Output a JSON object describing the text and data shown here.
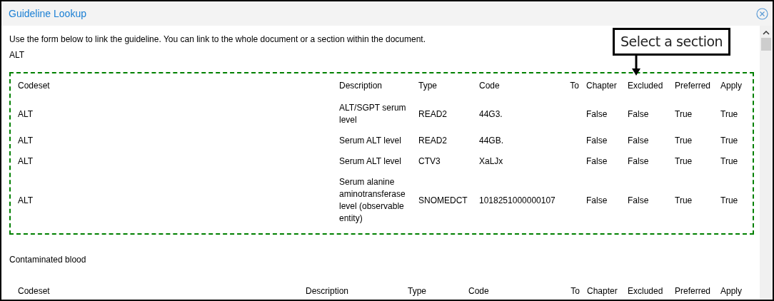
{
  "window": {
    "title": "Guideline Lookup"
  },
  "intro": "Use the form below to link the guideline. You can link to the whole document or a section within the document.",
  "callout": {
    "text": "Select a section"
  },
  "sections": [
    {
      "title": "ALT",
      "highlighted": true,
      "columns": [
        "Codeset",
        "Description",
        "Type",
        "Code",
        "To",
        "Chapter",
        "Excluded",
        "Preferred",
        "Apply"
      ],
      "rows": [
        [
          "ALT",
          "ALT/SGPT serum level",
          "READ2",
          "44G3.",
          "",
          "False",
          "False",
          "True",
          "True"
        ],
        [
          "ALT",
          "Serum ALT level",
          "READ2",
          "44GB.",
          "",
          "False",
          "False",
          "True",
          "True"
        ],
        [
          "ALT",
          "Serum ALT level",
          "CTV3",
          "XaLJx",
          "",
          "False",
          "False",
          "True",
          "True"
        ],
        [
          "ALT",
          "Serum alanine aminotransferase level (observable entity)",
          "SNOMEDCT",
          "1018251000000107",
          "",
          "False",
          "False",
          "True",
          "True"
        ]
      ]
    },
    {
      "title": "Contaminated blood",
      "columns": [
        "Codeset",
        "Description",
        "Type",
        "Code",
        "To",
        "Chapter",
        "Excluded",
        "Preferred",
        "Apply"
      ]
    }
  ]
}
